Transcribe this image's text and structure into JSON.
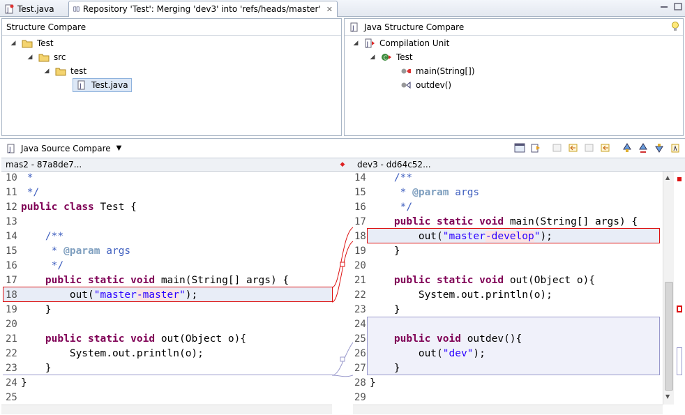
{
  "tabs": [
    {
      "label": "Test.java"
    },
    {
      "label": "Repository 'Test': Merging 'dev3' into 'refs/heads/master'"
    }
  ],
  "structure_compare": {
    "title": "Structure Compare",
    "tree": [
      {
        "label": "Test"
      },
      {
        "label": "src"
      },
      {
        "label": "test"
      },
      {
        "label": "Test.java"
      }
    ]
  },
  "java_structure_compare": {
    "title": "Java Structure Compare",
    "tree": [
      {
        "label": "Compilation Unit"
      },
      {
        "label": "Test"
      },
      {
        "label": "main(String[])"
      },
      {
        "label": "outdev()"
      }
    ]
  },
  "source_compare": {
    "title": "Java Source Compare",
    "left_header": "mas2 - 87a8de7...",
    "right_header": "dev3 - dd64c52..."
  },
  "left_lines": [
    {
      "n": "10",
      "t": " *"
    },
    {
      "n": "11",
      "t": " */"
    },
    {
      "n": "12",
      "t": "public class Test {"
    },
    {
      "n": "13",
      "t": ""
    },
    {
      "n": "14",
      "t": "    /**"
    },
    {
      "n": "15",
      "t": "     * @param args"
    },
    {
      "n": "16",
      "t": "     */"
    },
    {
      "n": "17",
      "t": "    public static void main(String[] args) {"
    },
    {
      "n": "18",
      "t": "        out(\"master-master\");"
    },
    {
      "n": "19",
      "t": "    }"
    },
    {
      "n": "20",
      "t": ""
    },
    {
      "n": "21",
      "t": "    public static void out(Object o){"
    },
    {
      "n": "22",
      "t": "        System.out.println(o);"
    },
    {
      "n": "23",
      "t": "    }"
    },
    {
      "n": "24",
      "t": "}"
    },
    {
      "n": "25",
      "t": ""
    }
  ],
  "right_lines": [
    {
      "n": "14",
      "t": "    /**"
    },
    {
      "n": "15",
      "t": "     * @param args"
    },
    {
      "n": "16",
      "t": "     */"
    },
    {
      "n": "17",
      "t": "    public static void main(String[] args) {"
    },
    {
      "n": "18",
      "t": "        out(\"master-develop\");"
    },
    {
      "n": "19",
      "t": "    }"
    },
    {
      "n": "20",
      "t": ""
    },
    {
      "n": "21",
      "t": "    public static void out(Object o){"
    },
    {
      "n": "22",
      "t": "        System.out.println(o);"
    },
    {
      "n": "23",
      "t": "    }"
    },
    {
      "n": "24",
      "t": ""
    },
    {
      "n": "25",
      "t": "    public void outdev(){"
    },
    {
      "n": "26",
      "t": "        out(\"dev\");"
    },
    {
      "n": "27",
      "t": "    }"
    },
    {
      "n": "28",
      "t": "}"
    },
    {
      "n": "29",
      "t": ""
    }
  ],
  "colors": {
    "keyword": "#7f0055",
    "string": "#2a00ff",
    "javadoc": "#3f5fbf",
    "conflict": "#dd1111"
  }
}
